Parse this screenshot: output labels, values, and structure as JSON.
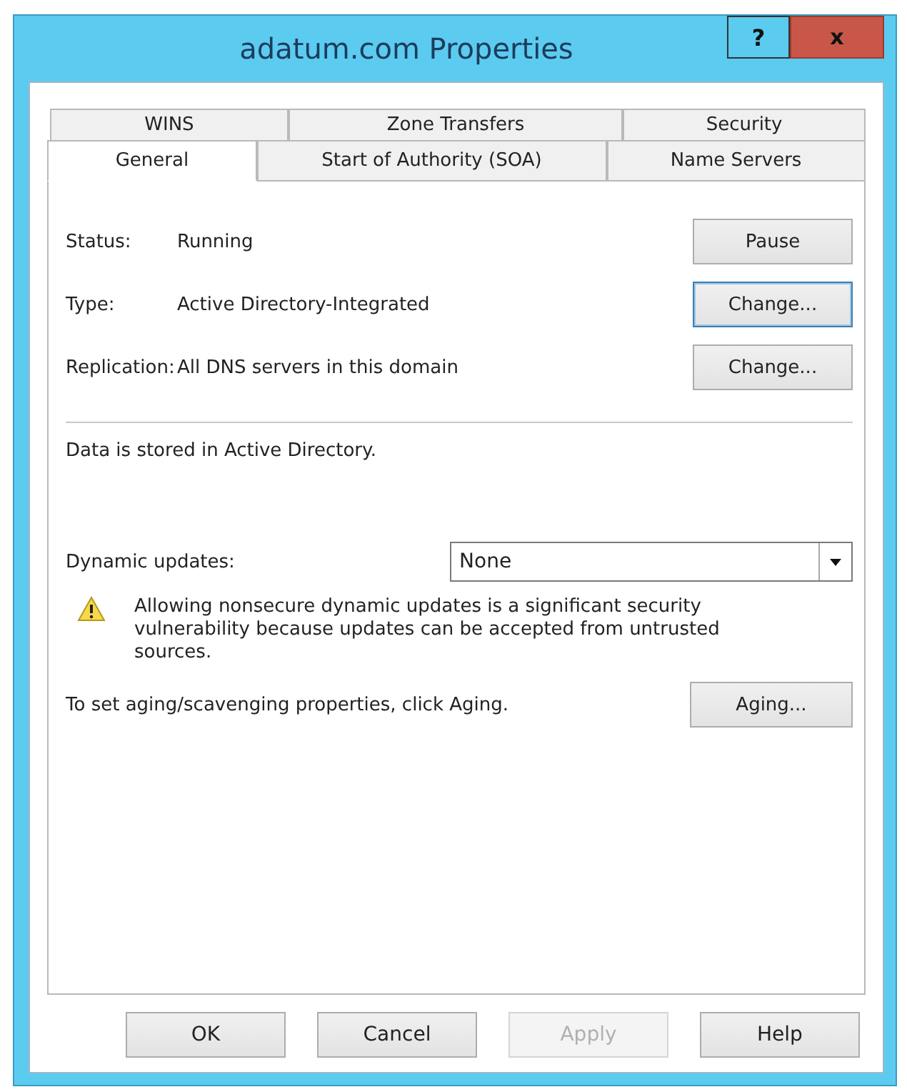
{
  "window": {
    "title": "adatum.com Properties",
    "help_button": "?",
    "close_button": "x"
  },
  "tabs": {
    "rows": [
      [
        {
          "label": "WINS",
          "selected": false
        },
        {
          "label": "Zone Transfers",
          "selected": false
        },
        {
          "label": "Security",
          "selected": false
        }
      ],
      [
        {
          "label": "General",
          "selected": true
        },
        {
          "label": "Start of Authority (SOA)",
          "selected": false
        },
        {
          "label": "Name Servers",
          "selected": false
        }
      ]
    ]
  },
  "general": {
    "fields": [
      {
        "label": "Status:",
        "value": "Running",
        "button": {
          "label": "Pause",
          "focused": false
        }
      },
      {
        "label": "Type:",
        "value": "Active Directory-Integrated",
        "button": {
          "label": "Change...",
          "focused": true
        }
      },
      {
        "label": "Replication:",
        "value": "All DNS servers in this domain",
        "button": {
          "label": "Change...",
          "focused": false
        }
      }
    ],
    "storage_note": "Data is stored in Active Directory.",
    "dynamic_updates": {
      "label": "Dynamic updates:",
      "value": "None"
    },
    "warning": "Allowing nonsecure dynamic updates is a significant security vulnerability because updates can be accepted from untrusted sources.",
    "aging": {
      "text": "To set aging/scavenging properties, click Aging.",
      "button": "Aging..."
    }
  },
  "buttons": [
    {
      "label": "OK",
      "disabled": false
    },
    {
      "label": "Cancel",
      "disabled": false
    },
    {
      "label": "Apply",
      "disabled": true
    },
    {
      "label": "Help",
      "disabled": false
    }
  ]
}
